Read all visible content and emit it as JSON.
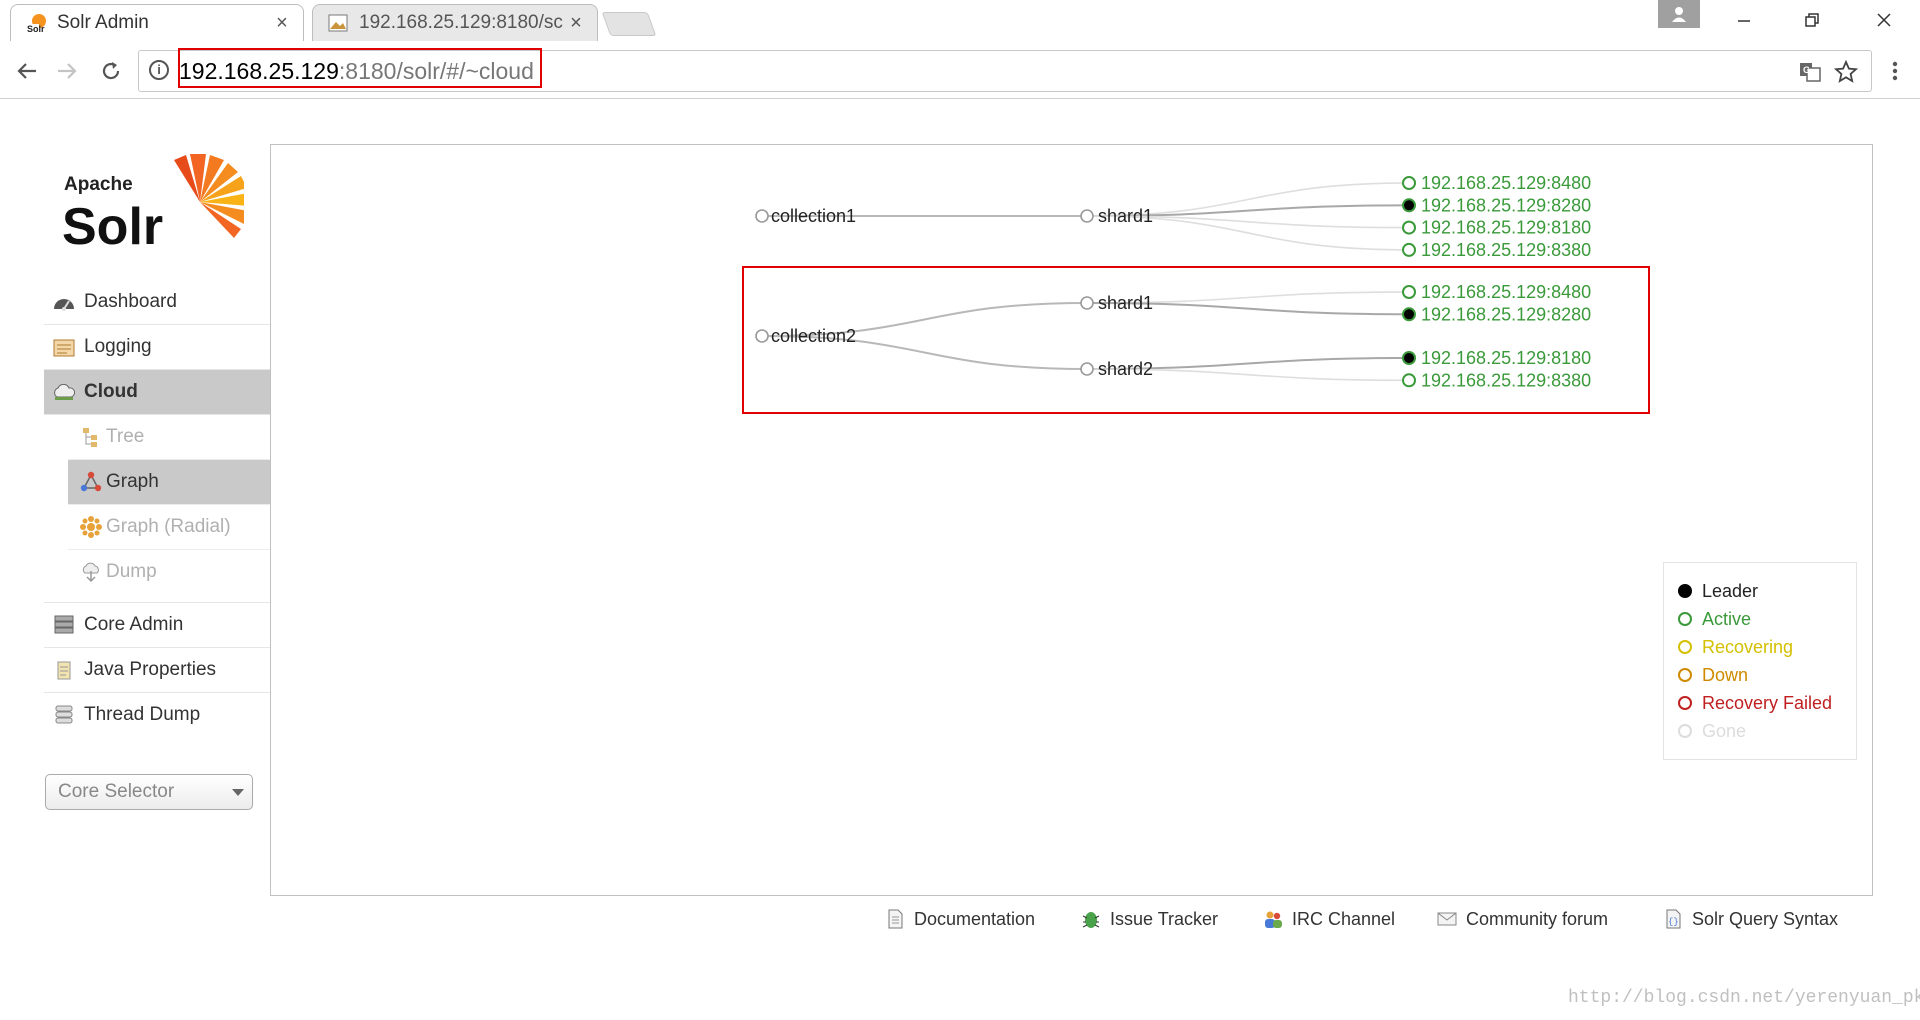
{
  "browser": {
    "tabs": [
      {
        "label": "Solr Admin",
        "close": "×"
      },
      {
        "label": "192.168.25.129:8180/sc",
        "close": "×"
      }
    ],
    "url": {
      "host": "192.168.25.129",
      "rest": ":8180/solr/#/~cloud"
    },
    "info_glyph": "i"
  },
  "logo": {
    "top_text": "Apache",
    "main_text": "Solr"
  },
  "sidebar": {
    "items": [
      {
        "label": "Dashboard",
        "icon": "dashboard-icon"
      },
      {
        "label": "Logging",
        "icon": "logging-icon"
      },
      {
        "label": "Cloud",
        "icon": "cloud-icon"
      }
    ],
    "cloud_sub": [
      {
        "label": "Tree",
        "icon": "tree-icon"
      },
      {
        "label": "Graph",
        "icon": "graph-icon"
      },
      {
        "label": "Graph (Radial)",
        "icon": "radial-icon"
      },
      {
        "label": "Dump",
        "icon": "dump-icon"
      }
    ],
    "items2": [
      {
        "label": "Core Admin",
        "icon": "core-admin-icon"
      },
      {
        "label": "Java Properties",
        "icon": "java-icon"
      },
      {
        "label": "Thread Dump",
        "icon": "thread-dump-icon"
      }
    ],
    "core_selector": "Core Selector"
  },
  "graph": {
    "collections": [
      {
        "name": "collection1",
        "shards": [
          {
            "name": "shard1",
            "replicas": [
              {
                "host": "192.168.25.129:8480",
                "leader": false
              },
              {
                "host": "192.168.25.129:8280",
                "leader": true
              },
              {
                "host": "192.168.25.129:8180",
                "leader": false
              },
              {
                "host": "192.168.25.129:8380",
                "leader": false
              }
            ]
          }
        ]
      },
      {
        "name": "collection2",
        "shards": [
          {
            "name": "shard1",
            "replicas": [
              {
                "host": "192.168.25.129:8480",
                "leader": false
              },
              {
                "host": "192.168.25.129:8280",
                "leader": true
              }
            ]
          },
          {
            "name": "shard2",
            "replicas": [
              {
                "host": "192.168.25.129:8180",
                "leader": true
              },
              {
                "host": "192.168.25.129:8380",
                "leader": false
              }
            ]
          }
        ]
      }
    ]
  },
  "legend": [
    {
      "label": "Leader",
      "color": "#000000",
      "filled": true
    },
    {
      "label": "Active",
      "color": "#3a9a3a",
      "filled": false
    },
    {
      "label": "Recovering",
      "color": "#d4c000",
      "filled": false
    },
    {
      "label": "Down",
      "color": "#d08a00",
      "filled": false
    },
    {
      "label": "Recovery Failed",
      "color": "#c02020",
      "filled": false
    },
    {
      "label": "Gone",
      "color": "#dcdcdc",
      "filled": false
    }
  ],
  "footer": [
    {
      "label": "Documentation",
      "icon": "documentation-icon"
    },
    {
      "label": "Issue Tracker",
      "icon": "bug-icon"
    },
    {
      "label": "IRC Channel",
      "icon": "irc-icon"
    },
    {
      "label": "Community forum",
      "icon": "mail-icon"
    },
    {
      "label": "Solr Query Syntax",
      "icon": "query-syntax-icon"
    }
  ],
  "watermark": "http://blog.csdn.net/yerenyuan_pku"
}
